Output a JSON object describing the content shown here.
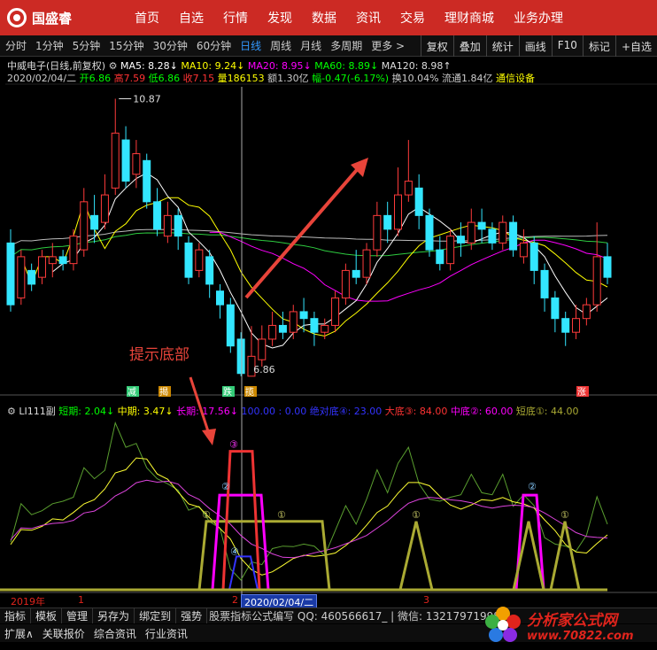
{
  "app": {
    "logo_text": "国盛睿"
  },
  "main_nav": [
    "首页",
    "自选",
    "行情",
    "发现",
    "数据",
    "资讯",
    "交易",
    "理财商城",
    "业务办理"
  ],
  "period_tabs": [
    "分时",
    "1分钟",
    "5分钟",
    "15分钟",
    "30分钟",
    "60分钟",
    "日线",
    "周线",
    "月线",
    "多周期",
    "更多 >"
  ],
  "period_active": "日线",
  "right_tools": [
    "复权",
    "叠加",
    "统计",
    "画线",
    "F10",
    "标记",
    "+自选"
  ],
  "stock": {
    "name_line": "中威电子(日线,前复权)",
    "ma5": "MA5: 8.28↓",
    "ma10": "MA10: 9.24↓",
    "ma20": "MA20: 8.95↓",
    "ma60": "MA60: 8.89↓",
    "ma120": "MA120: 8.98↑",
    "date": "2020/02/04/二",
    "open": "开6.86",
    "high": "高7.59",
    "low": "低6.86",
    "close": "收7.15",
    "vol": "量186153",
    "amount": "额1.30亿",
    "change": "幅-0.47(-6.17%)",
    "turnover": "换10.04%",
    "float": "流通1.84亿",
    "sector": "通信设备",
    "high_mark": "10.87",
    "low_mark": "6.86",
    "markers": [
      "减",
      "揭",
      "跌",
      "揽",
      "涨"
    ]
  },
  "sub_indicator": {
    "name": "LI111副",
    "short": "短期: 2.04↓",
    "mid": "中期: 3.47↓",
    "long": "长期: 17.56↓",
    "v100": "100.00 : 0.00",
    "abs_bottom": "绝对底④: 23.00",
    "big_bottom": "大底③: 84.00",
    "mid_bottom": "中底②: 60.00",
    "short_bottom": "短底①: 44.00"
  },
  "x_axis": {
    "year": "2019年",
    "m1": "1",
    "m2": "2",
    "m3": "3",
    "cursor_date": "2020/02/04/二"
  },
  "annotation": "提示底部",
  "bottom_tabs": [
    "指标",
    "模板",
    "管理",
    "另存为",
    "绑定到",
    "强势"
  ],
  "bottom_text": "股票指标公式编写 QQ: 460566617_ | 微信: 13217971998",
  "bottom_tabs2": [
    "扩展∧",
    "关联报价",
    "综合资讯",
    "行业资讯"
  ],
  "watermark": {
    "line1": "分析家公式网",
    "line2": "www.70822.com"
  },
  "chart_data": {
    "type": "candlestick",
    "candles": [
      [
        8.8,
        7.9,
        9.0,
        7.8
      ],
      [
        8.0,
        8.6,
        8.7,
        7.9
      ],
      [
        8.4,
        8.2,
        8.5,
        8.1
      ],
      [
        8.3,
        8.6,
        8.7,
        8.2
      ],
      [
        8.5,
        8.6,
        8.8,
        8.3
      ],
      [
        8.6,
        8.5,
        8.7,
        8.4
      ],
      [
        8.5,
        8.9,
        9.0,
        8.4
      ],
      [
        8.7,
        9.4,
        9.6,
        8.6
      ],
      [
        9.2,
        9.0,
        9.5,
        8.8
      ],
      [
        9.1,
        9.5,
        9.8,
        9.0
      ],
      [
        9.6,
        10.4,
        10.9,
        9.5
      ],
      [
        10.3,
        9.7,
        10.5,
        9.6
      ],
      [
        9.8,
        10.1,
        10.3,
        9.6
      ],
      [
        10.0,
        9.4,
        10.1,
        9.3
      ],
      [
        9.4,
        9.0,
        9.6,
        8.9
      ],
      [
        8.9,
        9.2,
        9.4,
        8.8
      ],
      [
        9.2,
        8.9,
        9.3,
        8.7
      ],
      [
        8.8,
        8.3,
        8.9,
        8.2
      ],
      [
        8.4,
        8.7,
        8.8,
        8.3
      ],
      [
        8.6,
        8.2,
        8.7,
        8.0
      ],
      [
        8.1,
        7.9,
        8.2,
        7.7
      ],
      [
        7.9,
        7.3,
        8.0,
        7.2
      ],
      [
        7.4,
        6.9,
        7.5,
        6.86
      ],
      [
        6.86,
        7.15,
        7.59,
        6.86
      ],
      [
        7.1,
        7.4,
        7.6,
        7.0
      ],
      [
        7.4,
        7.6,
        7.8,
        7.3
      ],
      [
        7.6,
        7.5,
        7.8,
        7.4
      ],
      [
        7.5,
        7.8,
        7.9,
        7.4
      ],
      [
        7.8,
        7.7,
        8.0,
        7.5
      ],
      [
        7.7,
        7.5,
        7.8,
        7.3
      ],
      [
        7.5,
        7.6,
        7.7,
        7.4
      ],
      [
        7.6,
        8.0,
        8.1,
        7.5
      ],
      [
        8.0,
        8.4,
        8.5,
        7.9
      ],
      [
        8.4,
        8.3,
        8.7,
        8.2
      ],
      [
        8.3,
        8.7,
        8.8,
        8.2
      ],
      [
        8.7,
        9.2,
        9.4,
        8.6
      ],
      [
        9.2,
        9.0,
        9.4,
        8.8
      ],
      [
        9.0,
        9.5,
        9.9,
        8.9
      ],
      [
        9.5,
        9.7,
        10.3,
        9.4
      ],
      [
        9.6,
        9.2,
        9.8,
        9.0
      ],
      [
        9.2,
        8.7,
        9.3,
        8.6
      ],
      [
        8.7,
        8.5,
        8.9,
        8.4
      ],
      [
        8.5,
        8.9,
        9.0,
        8.4
      ],
      [
        8.9,
        8.8,
        9.1,
        8.6
      ],
      [
        8.8,
        9.1,
        9.3,
        8.7
      ],
      [
        9.1,
        9.0,
        9.3,
        8.8
      ],
      [
        9.0,
        8.8,
        9.1,
        8.7
      ],
      [
        8.8,
        9.1,
        9.2,
        8.7
      ],
      [
        9.1,
        8.7,
        9.2,
        8.6
      ],
      [
        8.6,
        8.8,
        9.0,
        8.5
      ],
      [
        8.8,
        8.4,
        8.9,
        8.2
      ],
      [
        8.4,
        8.0,
        8.5,
        7.8
      ],
      [
        8.0,
        7.7,
        8.1,
        7.5
      ],
      [
        7.7,
        7.5,
        7.8,
        7.3
      ],
      [
        7.5,
        7.7,
        7.9,
        7.4
      ],
      [
        7.7,
        7.9,
        8.0,
        7.6
      ],
      [
        7.9,
        8.6,
        9.1,
        7.8
      ],
      [
        8.6,
        8.3,
        8.8,
        8.2
      ]
    ],
    "high_label": "10.87",
    "low_label": "6.86"
  }
}
